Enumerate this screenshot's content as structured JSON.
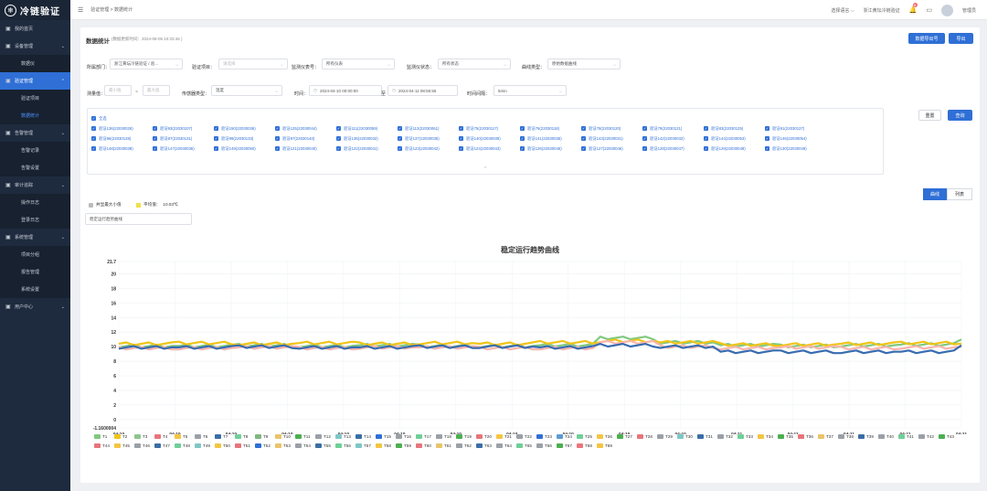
{
  "app": {
    "logo_text": "冷链验证"
  },
  "sidebar": {
    "items": [
      {
        "label": "我的首页",
        "icon": "home-icon",
        "type": "top",
        "active": false,
        "chev": false
      },
      {
        "label": "设备管理",
        "icon": "device-icon",
        "type": "top",
        "active": false,
        "chev": true
      },
      {
        "label": "数据仪",
        "type": "sub",
        "active": false
      },
      {
        "label": "验证管理",
        "icon": "check-icon",
        "type": "top",
        "active": true,
        "chev": true
      },
      {
        "label": "验证项目",
        "type": "sub",
        "active": false
      },
      {
        "label": "数据统计",
        "type": "sub",
        "active": true
      },
      {
        "label": "告警管理",
        "icon": "alarm-icon",
        "type": "top",
        "active": false,
        "chev": true
      },
      {
        "label": "告警记录",
        "type": "sub",
        "active": false
      },
      {
        "label": "告警设置",
        "type": "sub",
        "active": false
      },
      {
        "label": "审计追踪",
        "icon": "audit-icon",
        "type": "top",
        "active": false,
        "chev": true
      },
      {
        "label": "操作日志",
        "type": "sub",
        "active": false
      },
      {
        "label": "登录日志",
        "type": "sub",
        "active": false
      },
      {
        "label": "系统管理",
        "icon": "system-icon",
        "type": "top",
        "active": false,
        "chev": true
      },
      {
        "label": "项目分组",
        "type": "sub",
        "active": false
      },
      {
        "label": "报告管理",
        "type": "sub",
        "active": false
      },
      {
        "label": "系统设置",
        "type": "sub",
        "active": false
      },
      {
        "label": "用户中心",
        "icon": "user-icon",
        "type": "top",
        "active": false,
        "chev": true
      }
    ]
  },
  "topbar": {
    "breadcrumb": "验证管理 > 数据统计",
    "language": "选择语言",
    "company": "浙江黄坛冷链验证",
    "notification_count": "6",
    "username": "管理员"
  },
  "page": {
    "title": "数据统计",
    "updated": "(数据更新时间：2024-08-05 10:33:46 )",
    "export_sensor_label": "数据导出号",
    "export_label": "导出",
    "reset_label": "重置",
    "query_label": "查询"
  },
  "filters": {
    "dept_label": "所属部门：",
    "dept_value": "浙江黄坛冷链验证 / 验...",
    "project_label": "验证项目：",
    "project_placeholder": "请选择",
    "meter_label": "监测仪表号：",
    "meter_value": "所有仪表",
    "status_label": "监测仪状态：",
    "status_value": "所有状态",
    "curve_label": "曲线类型：",
    "curve_value": "原始数据曲线",
    "temp_label": "测量值：",
    "temp_min_placeholder": "最小值",
    "temp_sep": "~",
    "temp_max_placeholder": "最大值",
    "sensor_type_label": "传感器类型：",
    "sensor_type_value": "温度",
    "time_label": "时间：",
    "time_start": "2024-04-10 00:00:00",
    "time_to": "至",
    "time_end": "2024-04-11 08:55:55",
    "interval_label": "时间间隔：",
    "interval_value": "5min"
  },
  "sensors": {
    "all_label": "全选",
    "items": [
      "验证136(22030026)",
      "验证93(22030107)",
      "验证150(22030036)",
      "验证125(22030044)",
      "验证111(22030059)",
      "验证113(22030061)",
      "验证75(22030117)",
      "验证76(22030118)",
      "验证78(22030120)",
      "验证79(22030121)",
      "验证83(22030125)",
      "验证91(22030127)",
      "验证86(22030128)",
      "验证87(22030131)",
      "验证99(22030133)",
      "验证97(22030140)",
      "验证135(22030032)",
      "验证137(22030035)",
      "验证140(22030039)",
      "验证141(22030035)",
      "验证143(22030031)",
      "验证142(22030032)",
      "验证144(22030053)",
      "验证146(22030054)",
      "验证148(22030038)",
      "验证147(22030036)",
      "验证149(22030050)",
      "验证121(22030040)",
      "验证122(22030041)",
      "验证123(22030042)",
      "验证124(22030043)",
      "验证126(22030045)",
      "验证127(22030046)",
      "验证128(22030047)",
      "验证129(22030048)",
      "验证130(22030049)"
    ]
  },
  "stats": {
    "extreme_label": "并显最大小值",
    "avg_label": "平均值：",
    "avg_value": "10.03℃",
    "curve_select": "稳定运行趋势曲线"
  },
  "chart_tabs": {
    "curve": "曲线",
    "table": "列表"
  },
  "chart_data": {
    "type": "line",
    "title": "稳定运行趋势曲线",
    "y_ticks": [
      "21.7",
      "20",
      "18",
      "16",
      "14",
      "12",
      "10",
      "8",
      "6",
      "4",
      "2",
      "0",
      "-1.1600004"
    ],
    "ylim": [
      -1.16,
      21.7
    ],
    "x_ticks": [
      [
        "04-10",
        "00:00"
      ],
      [
        "04-10",
        "02:15"
      ],
      [
        "04-10",
        "04:30"
      ],
      [
        "04-10",
        "06:45"
      ],
      [
        "04-10",
        "09:00"
      ],
      [
        "04-10",
        "11:15"
      ],
      [
        "04-10",
        "13:30"
      ],
      [
        "04-10",
        "15:45"
      ],
      [
        "04-10",
        "18:00"
      ],
      [
        "04-10",
        "20:15"
      ],
      [
        "04-10",
        "22:30"
      ],
      [
        "04-11",
        "00:45"
      ],
      [
        "04-11",
        "03:00"
      ],
      [
        "04-11",
        "05:15"
      ],
      [
        "04-11",
        "07:30"
      ],
      [
        "04-11",
        "08:55"
      ]
    ],
    "series_summary": [
      {
        "name": "T1",
        "color": "#7fc97f",
        "values": [
          10.1,
          10.1,
          10.2,
          10.1,
          10.2,
          10.1,
          10.1,
          10.2,
          11.2,
          10.6,
          10.2,
          10.1,
          10.2,
          10.3,
          10.8
        ]
      },
      {
        "name": "T2",
        "color": "#f0c419",
        "values": [
          10.4,
          10.5,
          10.4,
          10.5,
          10.4,
          10.5,
          10.4,
          10.6,
          10.8,
          10.6,
          10.3,
          10.3,
          10.4,
          10.5,
          10.6
        ]
      },
      {
        "name": "T4",
        "color": "#fbb4ae",
        "values": [
          9.8,
          9.8,
          9.9,
          9.8,
          9.9,
          9.9,
          9.8,
          9.8,
          10.6,
          10.0,
          9.8,
          9.9,
          9.8,
          9.9,
          10.0
        ]
      },
      {
        "name": "T23",
        "color": "#386cb0",
        "values": [
          9.9,
          9.9,
          10.0,
          9.9,
          9.9,
          10.0,
          10.0,
          9.9,
          10.2,
          10.0,
          9.3,
          9.3,
          9.3,
          9.3,
          10.0
        ]
      }
    ]
  },
  "legend": [
    {
      "name": "T1",
      "color": "#7fc97f"
    },
    {
      "name": "T2",
      "color": "#f0c419"
    },
    {
      "name": "T3",
      "color": "#8cc68c"
    },
    {
      "name": "T4",
      "color": "#e8747c"
    },
    {
      "name": "T5",
      "color": "#f4c542"
    },
    {
      "name": "T6",
      "color": "#9aa0a6"
    },
    {
      "name": "T7",
      "color": "#3a6ea5"
    },
    {
      "name": "T8",
      "color": "#6fcf97"
    },
    {
      "name": "T9",
      "color": "#7fb77e"
    },
    {
      "name": "T10",
      "color": "#e9c46a"
    },
    {
      "name": "T11",
      "color": "#4caf50"
    },
    {
      "name": "T12",
      "color": "#9aa0a6"
    },
    {
      "name": "T13",
      "color": "#7fc7c7"
    },
    {
      "name": "T14",
      "color": "#3a6ea5"
    },
    {
      "name": "T15",
      "color": "#2f6fd6"
    },
    {
      "name": "T16",
      "color": "#9aa0a6"
    },
    {
      "name": "T17",
      "color": "#6fcf97"
    },
    {
      "name": "T18",
      "color": "#9aa0a6"
    },
    {
      "name": "T19",
      "color": "#4caf50"
    },
    {
      "name": "T20",
      "color": "#e8747c"
    },
    {
      "name": "T21",
      "color": "#f4c542"
    },
    {
      "name": "T22",
      "color": "#9aa0a6"
    },
    {
      "name": "T23",
      "color": "#2f6fd6"
    },
    {
      "name": "T24",
      "color": "#5b9bd5"
    },
    {
      "name": "T25",
      "color": "#6fcf97"
    },
    {
      "name": "T26",
      "color": "#f4c542"
    },
    {
      "name": "T27",
      "color": "#4caf50"
    },
    {
      "name": "T28",
      "color": "#e8747c"
    },
    {
      "name": "T29",
      "color": "#9aa0a6"
    },
    {
      "name": "T30",
      "color": "#7fc7c7"
    },
    {
      "name": "T31",
      "color": "#3a6ea5"
    },
    {
      "name": "T32",
      "color": "#9aa0a6"
    },
    {
      "name": "T33",
      "color": "#6fcf97"
    },
    {
      "name": "T34",
      "color": "#f4c542"
    },
    {
      "name": "T35",
      "color": "#4caf50"
    },
    {
      "name": "T36",
      "color": "#e8747c"
    },
    {
      "name": "T37",
      "color": "#e9c46a"
    },
    {
      "name": "T38",
      "color": "#9aa0a6"
    },
    {
      "name": "T39",
      "color": "#3a6ea5"
    },
    {
      "name": "T40",
      "color": "#9aa0a6"
    },
    {
      "name": "T41",
      "color": "#6fcf97"
    },
    {
      "name": "T42",
      "color": "#9aa0a6"
    },
    {
      "name": "T43",
      "color": "#4caf50"
    },
    {
      "name": "T44",
      "color": "#e8747c"
    },
    {
      "name": "T45",
      "color": "#f4c542"
    },
    {
      "name": "T46",
      "color": "#9aa0a6"
    },
    {
      "name": "T47",
      "color": "#3a6ea5"
    },
    {
      "name": "T48",
      "color": "#6fcf97"
    },
    {
      "name": "T49",
      "color": "#7fc7c7"
    },
    {
      "name": "T50",
      "color": "#f4c542"
    },
    {
      "name": "T51",
      "color": "#e8747c"
    },
    {
      "name": "T52",
      "color": "#2f6fd6"
    },
    {
      "name": "T53",
      "color": "#e9c46a"
    },
    {
      "name": "T54",
      "color": "#9aa0a6"
    },
    {
      "name": "T55",
      "color": "#3a6ea5"
    },
    {
      "name": "T56",
      "color": "#6fcf97"
    },
    {
      "name": "T57",
      "color": "#7fc7c7"
    },
    {
      "name": "T58",
      "color": "#f4c542"
    },
    {
      "name": "T59",
      "color": "#4caf50"
    },
    {
      "name": "T60",
      "color": "#e8747c"
    },
    {
      "name": "T61",
      "color": "#e9c46a"
    },
    {
      "name": "T62",
      "color": "#9aa0a6"
    },
    {
      "name": "T63",
      "color": "#3a6ea5"
    },
    {
      "name": "T64",
      "color": "#9aa0a6"
    },
    {
      "name": "T65",
      "color": "#6fcf97"
    },
    {
      "name": "T66",
      "color": "#9aa0a6"
    },
    {
      "name": "T67",
      "color": "#4caf50"
    },
    {
      "name": "T68",
      "color": "#e8747c"
    },
    {
      "name": "T69",
      "color": "#f4c542"
    }
  ]
}
